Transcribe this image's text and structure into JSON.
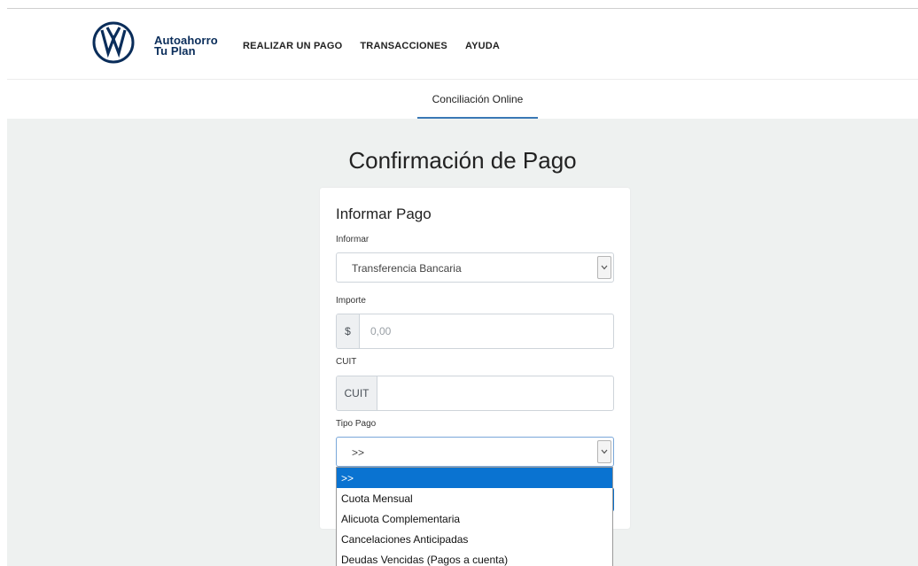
{
  "brand": {
    "line1": "Autoahorro",
    "line2": "Tu Plan"
  },
  "nav": {
    "items": [
      "REALIZAR UN PAGO",
      "TRANSACCIONES",
      "AYUDA"
    ]
  },
  "tab": {
    "label": "Conciliación Online"
  },
  "page": {
    "title": "Confirmación de Pago"
  },
  "form": {
    "title": "Informar Pago",
    "informar": {
      "label": "Informar",
      "value": "Transferencia Bancaria"
    },
    "importe": {
      "label": "Importe",
      "addon": "$",
      "placeholder": "0,00"
    },
    "cuit": {
      "label": "CUIT",
      "addon": "CUIT",
      "value": ""
    },
    "tipo_pago": {
      "label": "Tipo Pago",
      "value": ">>",
      "options": [
        ">>",
        "Cuota Mensual",
        "Alicuota Complementaria",
        "Cancelaciones Anticipadas",
        "Deudas Vencidas (Pagos a cuenta)"
      ],
      "selected_index": 0
    }
  },
  "colors": {
    "brand_navy": "#0a2d5a",
    "accent_blue": "#0a73d1",
    "tab_underline": "#3a78b5",
    "background": "#eef1f0"
  },
  "icons": {
    "logo": "vw-logo-icon",
    "select_arrow": "chevron-down-icon"
  }
}
